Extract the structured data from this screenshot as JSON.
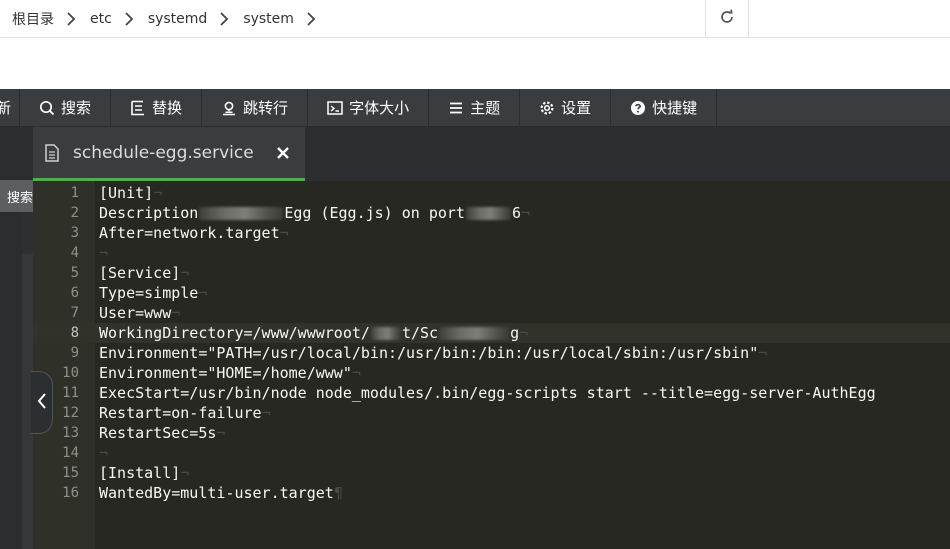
{
  "breadcrumb": {
    "items": [
      "根目录",
      "etc",
      "systemd",
      "system"
    ]
  },
  "toolbar": {
    "partial_label": "新",
    "search": "搜索",
    "replace": "替换",
    "goto": "跳转行",
    "font_size": "字体大小",
    "theme": "主题",
    "settings": "设置",
    "shortcuts": "快捷键"
  },
  "side": {
    "search_label": "搜索"
  },
  "tab": {
    "title": "schedule-egg.service"
  },
  "editor": {
    "active_line": 8,
    "lines": [
      {
        "n": "1",
        "pre": "[Unit]",
        "post": ""
      },
      {
        "n": "2",
        "pre": "Description",
        "post": "Egg (Egg.js) on port"
      },
      {
        "n": "3",
        "pre": "After=network.target",
        "post": ""
      },
      {
        "n": "4",
        "pre": "",
        "post": ""
      },
      {
        "n": "5",
        "pre": "[Service]",
        "post": ""
      },
      {
        "n": "6",
        "pre": "Type=simple",
        "post": ""
      },
      {
        "n": "7",
        "pre": "User=www",
        "post": ""
      },
      {
        "n": "8",
        "pre": "WorkingDirectory=/www/wwwroot/",
        "post": "t/Sc"
      },
      {
        "n": "9",
        "pre": "Environment=\"PATH=/usr/local/bin:/usr/bin:/bin:/usr/local/sbin:/usr/sbin\"",
        "post": ""
      },
      {
        "n": "10",
        "pre": "Environment=\"HOME=/home/www\"",
        "post": ""
      },
      {
        "n": "11",
        "pre": "ExecStart=/usr/bin/node node_modules/.bin/egg-scripts start --title=egg-server-AuthEgg",
        "post": ""
      },
      {
        "n": "12",
        "pre": "Restart=on-failure",
        "post": ""
      },
      {
        "n": "13",
        "pre": "RestartSec=5s",
        "post": ""
      },
      {
        "n": "14",
        "pre": "",
        "post": ""
      },
      {
        "n": "15",
        "pre": "[Install]",
        "post": ""
      },
      {
        "n": "16",
        "pre": "WantedBy=multi-user.target",
        "post": ""
      }
    ],
    "line2_tail": "6",
    "line8_tail": "g",
    "eol_mark": "¬",
    "eof_mark": "¶"
  },
  "colors": {
    "toolbar_bg": "#3a3d3f",
    "editor_bg": "#272822",
    "tab_active_underline": "#4caf50",
    "code_text": "#f8f8f2"
  }
}
